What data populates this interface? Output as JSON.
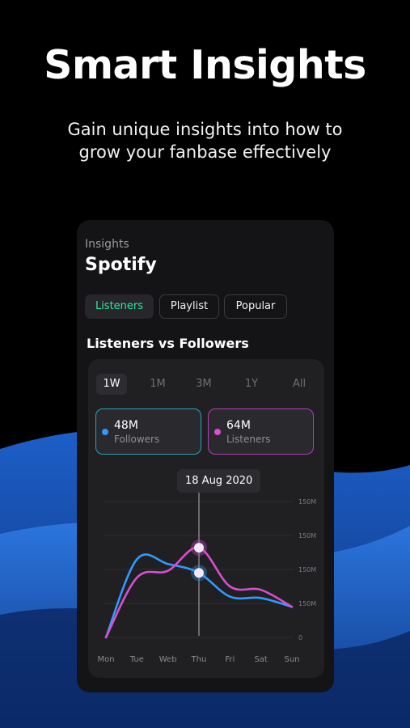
{
  "hero": {
    "title": "Smart Insights",
    "subtitle_line1": "Gain unique insights into how to",
    "subtitle_line2": "grow your fanbase effectively"
  },
  "phone": {
    "kicker": "Insights",
    "title": "Spotify",
    "tabs": [
      {
        "label": "Listeners",
        "active": true
      },
      {
        "label": "Playlist",
        "active": false
      },
      {
        "label": "Popular",
        "active": false
      }
    ],
    "section_title": "Listeners vs Followers",
    "ranges": [
      {
        "label": "1W",
        "active": true
      },
      {
        "label": "1M",
        "active": false
      },
      {
        "label": "3M",
        "active": false
      },
      {
        "label": "1Y",
        "active": false
      },
      {
        "label": "All",
        "active": false
      }
    ],
    "stats": [
      {
        "value": "48M",
        "label": "Followers",
        "color": "#2f9bff"
      },
      {
        "value": "64M",
        "label": "Listeners",
        "color": "#e04bd8"
      }
    ],
    "tooltip_date": "18 Aug 2020"
  },
  "chart_data": {
    "type": "line",
    "categories": [
      "Mon",
      "Tue",
      "Web",
      "Thu",
      "Fri",
      "Sat",
      "Sun"
    ],
    "y_tick_labels": [
      "0",
      "150M",
      "150M",
      "150M",
      "150M"
    ],
    "ylim": [
      0,
      200
    ],
    "grid": true,
    "series": [
      {
        "name": "Followers",
        "color": "#2f9bff",
        "values": [
          0,
          115,
          108,
          95,
          60,
          58,
          45
        ]
      },
      {
        "name": "Listeners",
        "color": "#d84fcf",
        "values": [
          0,
          88,
          98,
          132,
          75,
          70,
          45
        ]
      }
    ],
    "highlight_index": 3,
    "colors": {
      "accent": "#2ee6a1",
      "background": "#000000",
      "wave": "#1d63d6"
    }
  }
}
